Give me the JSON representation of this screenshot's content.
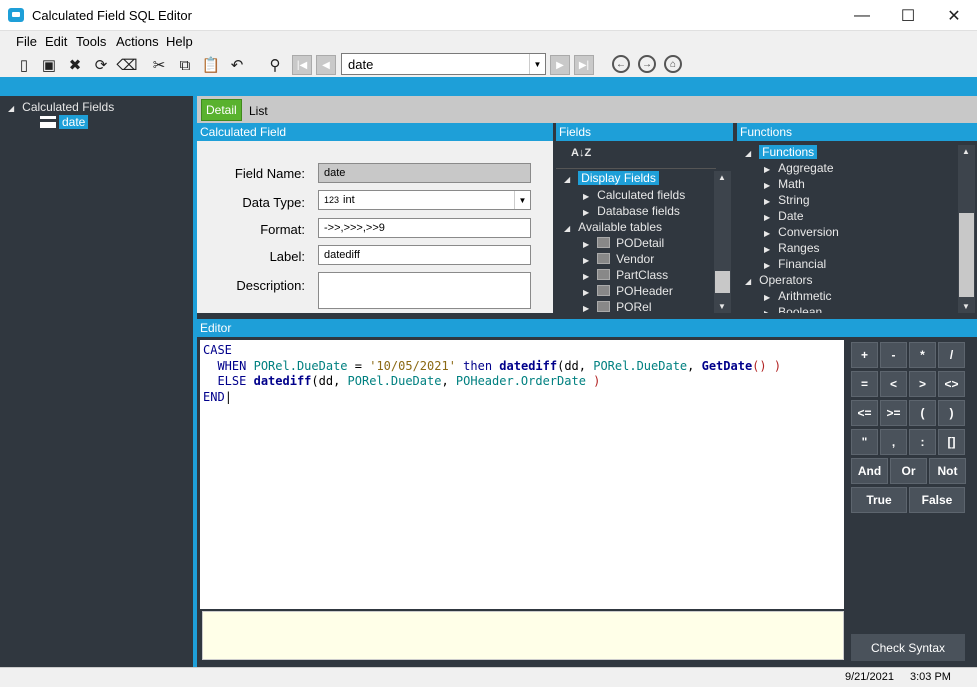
{
  "window": {
    "title": "Calculated Field SQL Editor",
    "minimize": "—",
    "maximize": "☐",
    "close": "✕"
  },
  "menu": [
    "File",
    "Edit",
    "Tools",
    "Actions",
    "Help"
  ],
  "toolbar": {
    "search_value": "date"
  },
  "tree": {
    "root": "Calculated Fields",
    "selected": "date"
  },
  "tabs": {
    "detail": "Detail",
    "list": "List"
  },
  "calculated_field": {
    "header": "Calculated Field",
    "field_name_label": "Field Name:",
    "field_name": "date",
    "data_type_label": "Data Type:",
    "data_type_prefix": "123",
    "data_type": "int",
    "format_label": "Format:",
    "format": "->>,>>>,>>9",
    "label_label": "Label:",
    "label": "datediff",
    "description_label": "Description:",
    "description": ""
  },
  "fields": {
    "header": "Fields",
    "sort_icon": "A↓Z",
    "display_fields": "Display Fields",
    "calculated_fields": "Calculated fields",
    "database_fields": "Database fields",
    "available_tables": "Available tables",
    "tables": [
      "PODetail",
      "Vendor",
      "PartClass",
      "POHeader",
      "PORel"
    ]
  },
  "functions": {
    "header": "Functions",
    "root": "Functions",
    "items": [
      "Aggregate",
      "Math",
      "String",
      "Date",
      "Conversion",
      "Ranges",
      "Financial"
    ],
    "operators": "Operators",
    "operator_items": [
      "Arithmetic",
      "Boolean"
    ]
  },
  "editor": {
    "header": "Editor",
    "line1": "CASE",
    "line2_when": "WHEN",
    "line2_col": "PORel.DueDate",
    "line2_eq": "=",
    "line2_str": "'10/05/2021'",
    "line2_then": "then",
    "line2_fn": "datediff",
    "line2_args1": "(dd, ",
    "line2_col2": "PORel.DueDate",
    "line2_comma": ", ",
    "line2_fn2": "GetDate",
    "line2_close": "() )",
    "line3_else": "ELSE",
    "line3_fn": "datediff",
    "line3_args": "(dd, ",
    "line3_col": "PORel.DueDate",
    "line3_comma": ", ",
    "line3_col2": "POHeader.OrderDate",
    "line3_close": " )",
    "line4": "END"
  },
  "operators": {
    "row1": [
      "+",
      "-",
      "*",
      "/"
    ],
    "row2": [
      "=",
      "<",
      ">",
      "<>"
    ],
    "row3": [
      "<=",
      ">=",
      "(",
      ")"
    ],
    "row4": [
      "\"",
      ",",
      ":",
      "[]"
    ],
    "row5": [
      "And",
      "Or",
      "Not"
    ],
    "row6": [
      "True",
      "False"
    ],
    "check_syntax": "Check Syntax"
  },
  "status": {
    "date": "9/21/2021",
    "time": "3:03 PM"
  }
}
